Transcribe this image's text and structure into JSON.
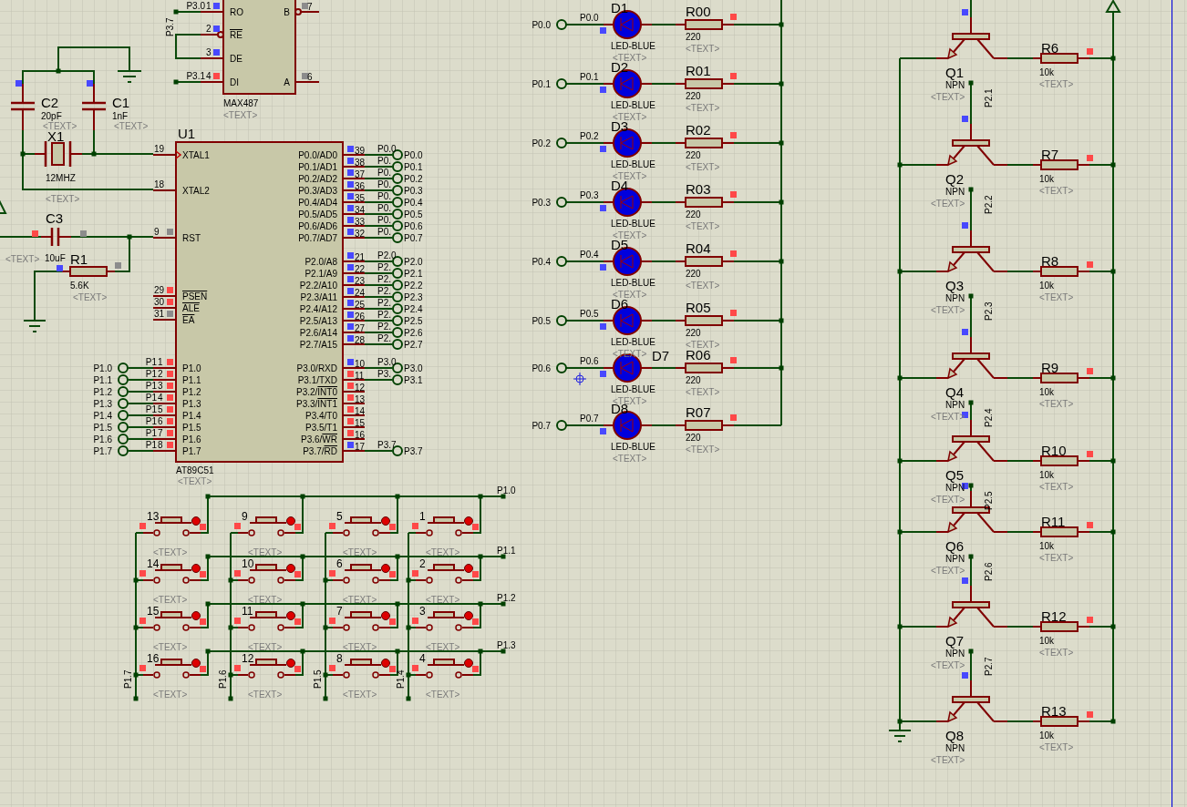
{
  "mcu": {
    "ref": "U1",
    "part": "AT89C51",
    "text": "<TEXT>",
    "left_pins": [
      {
        "num": "19",
        "name": "XTAL1",
        "kind": "clock"
      },
      {
        "num": "18",
        "name": "XTAL2",
        "kind": "plain"
      },
      {
        "num": "9",
        "name": "RST",
        "kind": "plain",
        "probe": {
          "color": "#8c8c8c"
        }
      },
      {
        "num": "29",
        "bar": "PSEN",
        "kind": "plain",
        "probe": {
          "color": "#ff4848"
        }
      },
      {
        "num": "30",
        "bar": "ALE",
        "kind": "plain",
        "probe": {
          "color": "#ff4848"
        }
      },
      {
        "num": "31",
        "bar": "EA",
        "kind": "plain",
        "probe": {
          "color": "#8c8c8c"
        }
      },
      {
        "num": "1",
        "name": "P1.0",
        "kind": "plain",
        "probe": {
          "color": "#ff4848"
        },
        "net": "P1",
        "terminal": "P1.0"
      },
      {
        "num": "2",
        "name": "P1.1",
        "kind": "plain",
        "probe": {
          "color": "#ff4848"
        },
        "net": "P1",
        "terminal": "P1.1"
      },
      {
        "num": "3",
        "name": "P1.2",
        "kind": "plain",
        "probe": {
          "color": "#ff4848"
        },
        "net": "P1",
        "terminal": "P1.2"
      },
      {
        "num": "4",
        "name": "P1.3",
        "kind": "plain",
        "probe": {
          "color": "#ff4848"
        },
        "net": "P1",
        "terminal": "P1.3"
      },
      {
        "num": "5",
        "name": "P1.4",
        "kind": "plain",
        "probe": {
          "color": "#ff4848"
        },
        "net": "P1",
        "terminal": "P1.4"
      },
      {
        "num": "6",
        "name": "P1.5",
        "kind": "plain",
        "probe": {
          "color": "#ff4848"
        },
        "net": "P1",
        "terminal": "P1.5"
      },
      {
        "num": "7",
        "name": "P1.6",
        "kind": "plain",
        "probe": {
          "color": "#ff4848"
        },
        "net": "P1",
        "terminal": "P1.6"
      },
      {
        "num": "8",
        "name": "P1.7",
        "kind": "plain",
        "probe": {
          "color": "#ff4848"
        },
        "net": "P1",
        "terminal": "P1.7"
      }
    ],
    "right_pins": [
      {
        "num": "39",
        "name": "P0.0/AD0",
        "probe": {
          "color": "#4848ff"
        },
        "net": "P0.0",
        "terminal": "P0.0"
      },
      {
        "num": "38",
        "name": "P0.1/AD1",
        "probe": {
          "color": "#4848ff"
        },
        "net": "P0.",
        "terminal": "P0.1"
      },
      {
        "num": "37",
        "name": "P0.2/AD2",
        "probe": {
          "color": "#4848ff"
        },
        "net": "P0.",
        "terminal": "P0.2"
      },
      {
        "num": "36",
        "name": "P0.3/AD3",
        "probe": {
          "color": "#4848ff"
        },
        "net": "P0.",
        "terminal": "P0.3"
      },
      {
        "num": "35",
        "name": "P0.4/AD4",
        "probe": {
          "color": "#4848ff"
        },
        "net": "P0.",
        "terminal": "P0.4"
      },
      {
        "num": "34",
        "name": "P0.5/AD5",
        "probe": {
          "color": "#4848ff"
        },
        "net": "P0.",
        "terminal": "P0.5"
      },
      {
        "num": "33",
        "name": "P0.6/AD6",
        "probe": {
          "color": "#4848ff"
        },
        "net": "P0.",
        "terminal": "P0.6"
      },
      {
        "num": "32",
        "name": "P0.7/AD7",
        "probe": {
          "color": "#4848ff"
        },
        "net": "P0.",
        "terminal": "P0.7"
      },
      {
        "num": "21",
        "name": "P2.0/A8",
        "probe": {
          "color": "#4848ff"
        },
        "net": "P2.0",
        "terminal": "P2.0"
      },
      {
        "num": "22",
        "name": "P2.1/A9",
        "probe": {
          "color": "#4848ff"
        },
        "net": "P2.",
        "terminal": "P2.1"
      },
      {
        "num": "23",
        "name": "P2.2/A10",
        "probe": {
          "color": "#4848ff"
        },
        "net": "P2.",
        "terminal": "P2.2"
      },
      {
        "num": "24",
        "name": "P2.3/A11",
        "probe": {
          "color": "#4848ff"
        },
        "net": "P2.",
        "terminal": "P2.3"
      },
      {
        "num": "25",
        "name": "P2.4/A12",
        "probe": {
          "color": "#4848ff"
        },
        "net": "P2.",
        "terminal": "P2.4"
      },
      {
        "num": "26",
        "name": "P2.5/A13",
        "probe": {
          "color": "#4848ff"
        },
        "net": "P2.",
        "terminal": "P2.5"
      },
      {
        "num": "27",
        "name": "P2.6/A14",
        "probe": {
          "color": "#4848ff"
        },
        "net": "P2.",
        "terminal": "P2.6"
      },
      {
        "num": "28",
        "name": "P2.7/A15",
        "probe": {
          "color": "#4848ff"
        },
        "net": "P2.",
        "terminal": "P2.7"
      },
      {
        "num": "10",
        "name": "P3.0/RXD",
        "probe": {
          "color": "#4848ff"
        },
        "net": "P3.0",
        "terminal": "P3.0"
      },
      {
        "num": "11",
        "name": "P3.1/TXD",
        "probe": {
          "color": "#ff4848"
        },
        "net": "P3.",
        "terminal": "P3.1"
      },
      {
        "num": "12",
        "name": "P3.2/",
        "bar": "INT0",
        "probe": {
          "color": "#ff4848"
        }
      },
      {
        "num": "13",
        "name": "P3.3/",
        "bar": "INT1",
        "probe": {
          "color": "#ff4848"
        }
      },
      {
        "num": "14",
        "name": "P3.4/T0",
        "probe": {
          "color": "#ff4848"
        }
      },
      {
        "num": "15",
        "name": "P3.5/T1",
        "probe": {
          "color": "#ff4848"
        }
      },
      {
        "num": "16",
        "name": "P3.6/",
        "bar": "WR",
        "probe": {
          "color": "#ff4848"
        }
      },
      {
        "num": "17",
        "name": "P3.7/",
        "bar": "RD",
        "probe": {
          "color": "#4848ff"
        },
        "net": "P3.7",
        "terminal": "P3.7"
      }
    ]
  },
  "transceiver": {
    "part": "MAX487",
    "text": "<TEXT>",
    "net_label": "P3.7",
    "left_pins": [
      {
        "name": "RO",
        "num": "1",
        "net": "P3.0",
        "probe": {
          "color": "#4848ff"
        },
        "kind": "plain"
      },
      {
        "bar": "RE",
        "num": "2",
        "probe": {
          "color": "#4848ff"
        },
        "kind": "inverted"
      },
      {
        "name": "DE",
        "num": "3",
        "probe": {
          "color": "#4848ff"
        },
        "kind": "plain"
      },
      {
        "name": "DI",
        "num": "4",
        "net": "P3.1",
        "probe": {
          "color": "#ff4848"
        },
        "kind": "plain"
      }
    ],
    "right_pins": [
      {
        "name": "B",
        "num": "7",
        "probe": {
          "color": "#8c8c8c"
        },
        "kind": "inverted"
      },
      {
        "name": "A",
        "num": "6",
        "probe": {
          "color": "#8c8c8c"
        },
        "kind": "plain"
      }
    ]
  },
  "oscillator": {
    "crystal": {
      "ref": "X1",
      "value": "12MHZ",
      "text": "<TEXT>"
    },
    "caps": [
      {
        "ref": "C2",
        "value": "20pF",
        "text": "<TEXT>",
        "probe": {
          "color": "#4848ff"
        }
      },
      {
        "ref": "C1",
        "value": "1nF",
        "text": "<TEXT>",
        "probe": {
          "color": "#4848ff"
        }
      }
    ]
  },
  "reset": {
    "cap": {
      "ref": "C3",
      "value": "10uF",
      "text": "<TEXT>",
      "probes": [
        {
          "color": "#ff4848"
        },
        {
          "color": "#8c8c8c"
        }
      ]
    },
    "resistor": {
      "ref": "R1",
      "value": "5.6K",
      "text": "<TEXT>",
      "probes": [
        {
          "color": "#4848ff"
        },
        {
          "color": "#8c8c8c"
        }
      ]
    }
  },
  "keypad": {
    "columns": [
      {
        "net": "P1.7"
      },
      {
        "net": "P1.6"
      },
      {
        "net": "P1.5"
      },
      {
        "net": "P1.4"
      }
    ],
    "rows": [
      {
        "net": "P1.0",
        "keys": [
          {
            "label": "13",
            "text": "<TEXT>",
            "probes": [
              {
                "color": "#ff4848"
              },
              {
                "color": "#ff4848"
              }
            ]
          },
          {
            "label": "9",
            "text": "<TEXT>",
            "probes": [
              {
                "color": "#ff4848"
              },
              {
                "color": "#ff4848"
              }
            ]
          },
          {
            "label": "5",
            "text": "<TEXT>",
            "probes": [
              {
                "color": "#ff4848"
              },
              {
                "color": "#ff4848"
              }
            ]
          },
          {
            "label": "1",
            "text": "<TEXT>",
            "probes": [
              {
                "color": "#ff4848"
              },
              {
                "color": "#ff4848"
              }
            ]
          }
        ]
      },
      {
        "net": "P1.1",
        "keys": [
          {
            "label": "14",
            "text": "<TEXT>",
            "probes": [
              {
                "color": "#ff4848"
              },
              {
                "color": "#ff4848"
              }
            ]
          },
          {
            "label": "10",
            "text": "<TEXT>",
            "probes": [
              {
                "color": "#ff4848"
              },
              {
                "color": "#ff4848"
              }
            ]
          },
          {
            "label": "6",
            "text": "<TEXT>",
            "probes": [
              {
                "color": "#ff4848"
              },
              {
                "color": "#ff4848"
              }
            ]
          },
          {
            "label": "2",
            "text": "<TEXT>",
            "probes": [
              {
                "color": "#ff4848"
              },
              {
                "color": "#ff4848"
              }
            ]
          }
        ]
      },
      {
        "net": "P1.2",
        "keys": [
          {
            "label": "15",
            "text": "<TEXT>",
            "probes": [
              {
                "color": "#ff4848"
              },
              {
                "color": "#ff4848"
              }
            ]
          },
          {
            "label": "11",
            "text": "<TEXT>",
            "probes": [
              {
                "color": "#ff4848"
              },
              {
                "color": "#ff4848"
              }
            ]
          },
          {
            "label": "7",
            "text": "<TEXT>",
            "probes": [
              {
                "color": "#ff4848"
              },
              {
                "color": "#ff4848"
              }
            ]
          },
          {
            "label": "3",
            "text": "<TEXT>",
            "probes": [
              {
                "color": "#ff4848"
              },
              {
                "color": "#ff4848"
              }
            ]
          }
        ]
      },
      {
        "net": "P1.3",
        "keys": [
          {
            "label": "16",
            "text": "<TEXT>",
            "probes": [
              {
                "color": "#ff4848"
              },
              {
                "color": "#ff4848"
              }
            ]
          },
          {
            "label": "12",
            "text": "<TEXT>",
            "probes": [
              {
                "color": "#ff4848"
              },
              {
                "color": "#ff4848"
              }
            ]
          },
          {
            "label": "8",
            "text": "<TEXT>",
            "probes": [
              {
                "color": "#ff4848"
              },
              {
                "color": "#ff4848"
              }
            ]
          },
          {
            "label": "4",
            "text": "<TEXT>",
            "probes": [
              {
                "color": "#ff4848"
              },
              {
                "color": "#ff4848"
              }
            ]
          }
        ]
      }
    ]
  },
  "leds": [
    {
      "terminal": "P0.0",
      "net": "P0.0",
      "ref": "D1",
      "part": "LED-BLUE",
      "text": "<TEXT>",
      "probe": {
        "color": "#4848ff"
      },
      "resistor": {
        "ref": "R00",
        "value": "220",
        "text": "<TEXT>",
        "probe": {
          "color": "#ff4848"
        }
      }
    },
    {
      "terminal": "P0.1",
      "net": "P0.1",
      "ref": "D2",
      "part": "LED-BLUE",
      "text": "<TEXT>",
      "probe": {
        "color": "#4848ff"
      },
      "resistor": {
        "ref": "R01",
        "value": "220",
        "text": "<TEXT>",
        "probe": {
          "color": "#ff4848"
        }
      }
    },
    {
      "terminal": "P0.2",
      "net": "P0.2",
      "ref": "D3",
      "part": "LED-BLUE",
      "text": "<TEXT>",
      "probe": {
        "color": "#4848ff"
      },
      "resistor": {
        "ref": "R02",
        "value": "220",
        "text": "<TEXT>",
        "probe": {
          "color": "#ff4848"
        }
      }
    },
    {
      "terminal": "P0.3",
      "net": "P0.3",
      "ref": "D4",
      "part": "LED-BLUE",
      "text": "<TEXT>",
      "probe": {
        "color": "#4848ff"
      },
      "resistor": {
        "ref": "R03",
        "value": "220",
        "text": "<TEXT>",
        "probe": {
          "color": "#ff4848"
        }
      }
    },
    {
      "terminal": "P0.4",
      "net": "P0.4",
      "ref": "D5",
      "part": "LED-BLUE",
      "text": "<TEXT>",
      "probe": {
        "color": "#4848ff"
      },
      "resistor": {
        "ref": "R04",
        "value": "220",
        "text": "<TEXT>",
        "probe": {
          "color": "#ff4848"
        }
      }
    },
    {
      "terminal": "P0.5",
      "net": "P0.5",
      "ref": "D6",
      "part": "LED-BLUE",
      "text": "<TEXT>",
      "probe": {
        "color": "#4848ff"
      },
      "resistor": {
        "ref": "R05",
        "value": "220",
        "text": "<TEXT>",
        "probe": {
          "color": "#ff4848"
        }
      }
    },
    {
      "terminal": "P0.6",
      "net": "P0.6",
      "ref": "D7",
      "part": "LED-BLUE",
      "text": "<TEXT>",
      "probe": {
        "color": "#4848ff"
      },
      "resistor": {
        "ref": "R06",
        "value": "220",
        "text": "<TEXT>",
        "probe": {
          "color": "#ff4848"
        }
      }
    },
    {
      "terminal": "P0.7",
      "net": "P0.7",
      "ref": "D8",
      "part": "LED-BLUE",
      "text": "<TEXT>",
      "probe": {
        "color": "#4848ff"
      },
      "resistor": {
        "ref": "R07",
        "value": "220",
        "text": "<TEXT>",
        "probe": {
          "color": "#ff4848"
        }
      }
    }
  ],
  "drivers": [
    {
      "ref": "Q1",
      "type": "NPN",
      "text": "<TEXT>",
      "base_probe": {
        "color": "#4848ff"
      },
      "resistor": {
        "ref": "R6",
        "value": "10k",
        "text": "<TEXT>",
        "probe": {
          "color": "#ff4848"
        }
      }
    },
    {
      "ref": "Q2",
      "type": "NPN",
      "text": "<TEXT>",
      "base_net": "P2.1",
      "base_probe": {
        "color": "#4848ff"
      },
      "resistor": {
        "ref": "R7",
        "value": "10k",
        "text": "<TEXT>",
        "probe": {
          "color": "#ff4848"
        }
      }
    },
    {
      "ref": "Q3",
      "type": "NPN",
      "text": "<TEXT>",
      "base_net": "P2.2",
      "base_probe": {
        "color": "#4848ff"
      },
      "resistor": {
        "ref": "R8",
        "value": "10k",
        "text": "<TEXT>",
        "probe": {
          "color": "#ff4848"
        }
      }
    },
    {
      "ref": "Q4",
      "type": "NPN",
      "text": "<TEXT>",
      "base_net": "P2.3",
      "base_probe": {
        "color": "#4848ff"
      },
      "resistor": {
        "ref": "R9",
        "value": "10k",
        "text": "<TEXT>",
        "probe": {
          "color": "#ff4848"
        }
      }
    },
    {
      "ref": "Q5",
      "type": "NPN",
      "text": "<TEXT>",
      "base_net": "P2.4",
      "base_probe": {
        "color": "#4848ff"
      },
      "resistor": {
        "ref": "R10",
        "value": "10k",
        "text": "<TEXT>",
        "probe": {
          "color": "#ff4848"
        }
      }
    },
    {
      "ref": "Q6",
      "type": "NPN",
      "text": "<TEXT>",
      "base_net": "P2.5",
      "base_probe": {
        "color": "#4848ff"
      },
      "resistor": {
        "ref": "R11",
        "value": "10k",
        "text": "<TEXT>",
        "probe": {
          "color": "#ff4848"
        }
      }
    },
    {
      "ref": "Q7",
      "type": "NPN",
      "text": "<TEXT>",
      "base_net": "P2.6",
      "base_probe": {
        "color": "#4848ff"
      },
      "resistor": {
        "ref": "R12",
        "value": "10k",
        "text": "<TEXT>",
        "probe": {
          "color": "#ff4848"
        }
      }
    },
    {
      "ref": "Q8",
      "type": "NPN",
      "text": "<TEXT>",
      "base_net": "P2.7",
      "base_probe": {
        "color": "#4848ff"
      },
      "resistor": {
        "ref": "R13",
        "value": "10k",
        "text": "<TEXT>",
        "probe": {
          "color": "#ff4848"
        }
      }
    }
  ]
}
